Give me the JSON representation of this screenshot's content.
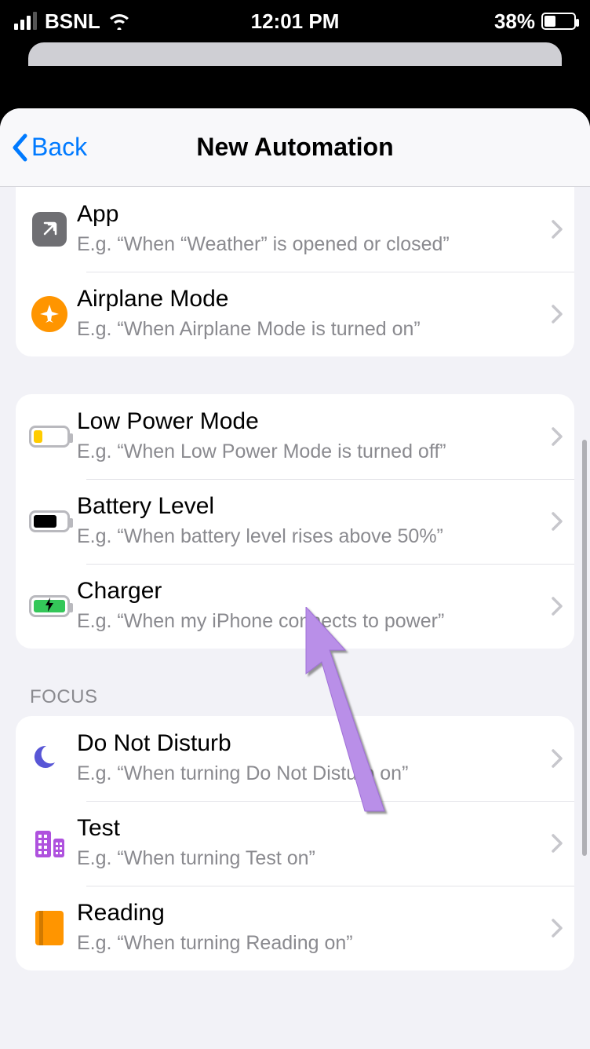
{
  "statusbar": {
    "carrier": "BSNL",
    "time": "12:01 PM",
    "battery_percent": "38%"
  },
  "nav": {
    "back_label": "Back",
    "title": "New Automation"
  },
  "groups": [
    {
      "header": null,
      "rows": [
        {
          "icon": "app",
          "title": "App",
          "subtitle": "E.g. “When “Weather” is opened or closed”"
        },
        {
          "icon": "airplane",
          "title": "Airplane Mode",
          "subtitle": "E.g. “When Airplane Mode is turned on”"
        }
      ]
    },
    {
      "header": null,
      "rows": [
        {
          "icon": "low-power",
          "title": "Low Power Mode",
          "subtitle": "E.g. “When Low Power Mode is turned off”"
        },
        {
          "icon": "battery-level",
          "title": "Battery Level",
          "subtitle": "E.g. “When battery level rises above 50%”"
        },
        {
          "icon": "charger",
          "title": "Charger",
          "subtitle": "E.g. “When my iPhone connects to power”"
        }
      ]
    },
    {
      "header": "FOCUS",
      "rows": [
        {
          "icon": "dnd",
          "title": "Do Not Disturb",
          "subtitle": "E.g. “When turning Do Not Disturb on”"
        },
        {
          "icon": "test",
          "title": "Test",
          "subtitle": "E.g. “When turning Test on”"
        },
        {
          "icon": "reading",
          "title": "Reading",
          "subtitle": "E.g. “When turning Reading on”"
        }
      ]
    }
  ]
}
